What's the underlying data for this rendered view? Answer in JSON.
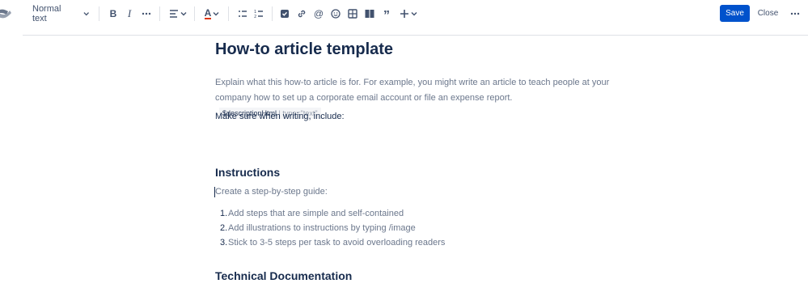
{
  "toolbar": {
    "text_style": "Normal text",
    "save_label": "Save",
    "close_label": "Close",
    "icons": [
      "confluence-logo",
      "chevron-down-icon",
      "bold-icon",
      "italic-icon",
      "more-formatting-icon",
      "align-icon",
      "text-color-icon",
      "bullet-list-icon",
      "numbered-list-icon",
      "task-icon",
      "link-icon",
      "mention-icon",
      "emoji-icon",
      "table-icon",
      "layout-icon",
      "quote-icon",
      "insert-plus-icon",
      "more-icon"
    ],
    "accent_color": "#0052cc"
  },
  "article": {
    "title": "How-to article template",
    "description": "Explain what this how-to article is for. For example, you might write an article to teach people at your company how to set up a corporate email account or file an expense report.",
    "macro_name": "$descriptionHtml",
    "macro_meta": "| type=\"text\"",
    "intro": "Make sure when writing, include:",
    "instructions_heading": "Instructions",
    "guide_prompt": "Create a step-by-step guide:",
    "steps": [
      {
        "num": "1.",
        "text": "Add steps that are simple and self-contained"
      },
      {
        "num": "2.",
        "text": "Add illustrations to instructions by typing /image"
      },
      {
        "num": "3.",
        "text": "Stick to 3-5 steps per task to avoid overloading readers"
      }
    ],
    "tech_heading": "Technical Documentation"
  }
}
